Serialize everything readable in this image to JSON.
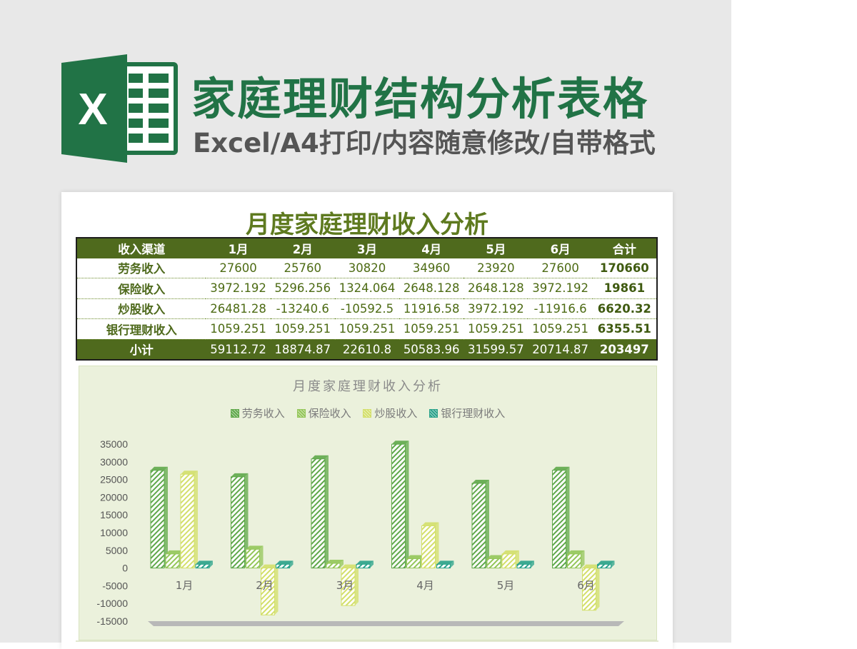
{
  "logo": {
    "letter": "X",
    "icon": "excel-logo-icon"
  },
  "header": {
    "title": "家庭理财结构分析表格",
    "subtitle": "Excel/A4打印/内容随意修改/自带格式"
  },
  "sheet": {
    "title": "月度家庭理财收入分析",
    "columns": [
      "收入渠道",
      "1月",
      "2月",
      "3月",
      "4月",
      "5月",
      "6月",
      "合计"
    ],
    "rows": [
      {
        "label": "劳务收入",
        "values": [
          "27600",
          "25760",
          "30820",
          "34960",
          "23920",
          "27600"
        ],
        "total": "170660"
      },
      {
        "label": "保险收入",
        "values": [
          "3972.192",
          "5296.256",
          "1324.064",
          "2648.128",
          "2648.128",
          "3972.192"
        ],
        "total": "19861"
      },
      {
        "label": "炒股收入",
        "values": [
          "26481.28",
          "-13240.6",
          "-10592.5",
          "11916.58",
          "3972.192",
          "-11916.6"
        ],
        "total": "6620.32"
      },
      {
        "label": "银行理财收入",
        "values": [
          "1059.251",
          "1059.251",
          "1059.251",
          "1059.251",
          "1059.251",
          "1059.251"
        ],
        "total": "6355.51"
      }
    ],
    "footer": {
      "label": "小计",
      "values": [
        "59112.72",
        "18874.87",
        "22610.8",
        "50583.96",
        "31599.57",
        "20714.87"
      ],
      "total": "203497"
    }
  },
  "colors": {
    "brand": "#217346",
    "header_row": "#4f6a1d",
    "title_text": "#5e7a1f",
    "chart_bg": "#ebf1dc",
    "series": [
      "#5fa84a",
      "#94c659",
      "#d3df6a",
      "#2aa28a"
    ]
  },
  "chart_data": {
    "type": "bar",
    "title": "月度家庭理财收入分析",
    "categories": [
      "1月",
      "2月",
      "3月",
      "4月",
      "5月",
      "6月"
    ],
    "series": [
      {
        "name": "劳务收入",
        "values": [
          27600,
          25760,
          30820,
          34960,
          23920,
          27600
        ]
      },
      {
        "name": "保险收入",
        "values": [
          3972.192,
          5296.256,
          1324.064,
          2648.128,
          2648.128,
          3972.192
        ]
      },
      {
        "name": "炒股收入",
        "values": [
          26481.28,
          -13240.6,
          -10592.5,
          11916.58,
          3972.192,
          -11916.6
        ]
      },
      {
        "name": "银行理财收入",
        "values": [
          1059.251,
          1059.251,
          1059.251,
          1059.251,
          1059.251,
          1059.251
        ]
      }
    ],
    "yticks": [
      "35000",
      "30000",
      "25000",
      "20000",
      "15000",
      "10000",
      "5000",
      "0",
      "-5000",
      "-10000",
      "-15000"
    ],
    "ylim": [
      -15000,
      35000
    ],
    "legend_position": "top",
    "grid": false,
    "style": "3d-clustered-column"
  }
}
